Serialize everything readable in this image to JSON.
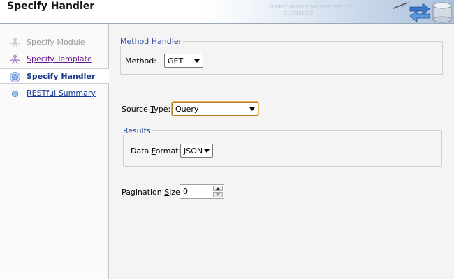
{
  "header": {
    "title": "Specify  Handler",
    "binary_decoration": "10101010110101010101010101101\n     0110101010"
  },
  "steps": [
    {
      "label": "Specify Module",
      "state": "disabled"
    },
    {
      "label": "Specify Template",
      "state": "visited"
    },
    {
      "label": "Specify  Handler",
      "state": "current"
    },
    {
      "label": "RESTful Summary",
      "state": "link"
    }
  ],
  "method_handler": {
    "legend": "Method Handler",
    "method_label": "Method:",
    "method_value": "GET"
  },
  "source_type": {
    "label_prefix": "Source ",
    "label_mnemonic": "T",
    "label_suffix": "ype:",
    "value": "Query"
  },
  "results": {
    "legend": "Results",
    "format_label_prefix": "Data ",
    "format_label_mnemonic": "F",
    "format_label_suffix": "ormat:",
    "format_value": "JSON"
  },
  "pagination": {
    "label_prefix": "Pagination ",
    "label_mnemonic": "S",
    "label_suffix": "ize:",
    "value": "0"
  },
  "colors": {
    "legend_blue": "#2a4a9a",
    "current_step": "#1a3a8a",
    "visited_step": "#6a1a8a",
    "focus_orange": "#e8b45a"
  }
}
